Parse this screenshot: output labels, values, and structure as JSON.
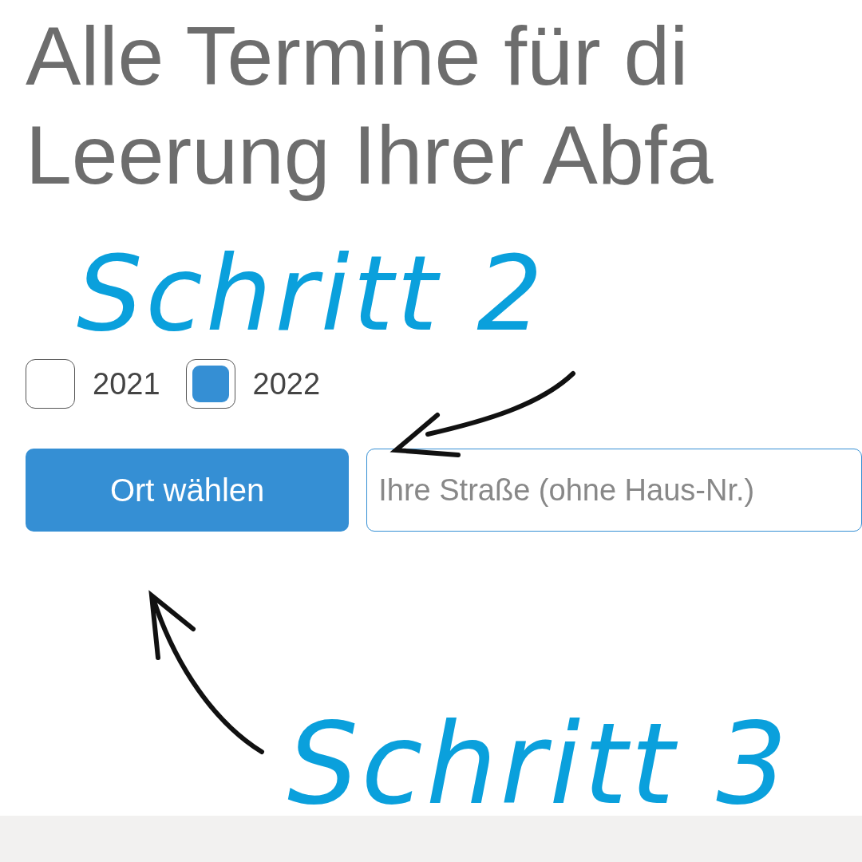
{
  "heading": [
    "Alle Termine für di",
    "Leerung Ihrer Abfa"
  ],
  "annotations": [
    {
      "text": "Schritt 2"
    },
    {
      "text": "Schritt 3"
    }
  ],
  "years": [
    {
      "label": "2021",
      "checked": false
    },
    {
      "label": "2022",
      "checked": true
    }
  ],
  "button": "Ort wählen",
  "street": {
    "placeholder": "Ihre Straße (ohne Haus-Nr.)"
  }
}
